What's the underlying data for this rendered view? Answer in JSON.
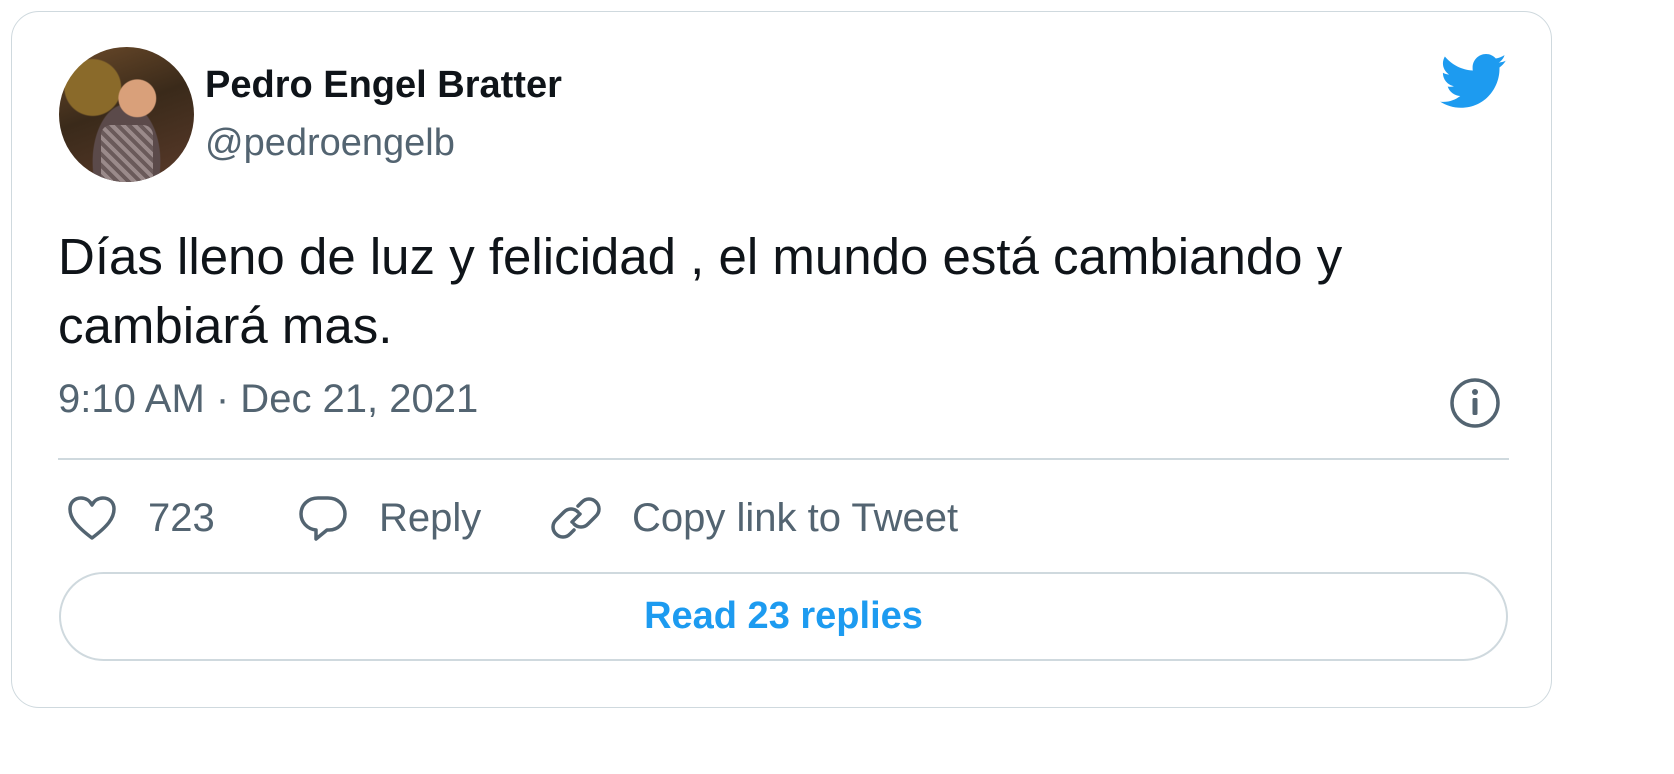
{
  "author": {
    "name": "Pedro Engel Bratter",
    "handle": "@pedroengelb",
    "avatar_icon": "user-photo"
  },
  "tweet": {
    "text": "Días lleno de luz y felicidad , el mundo está cambiando y cambiará mas.",
    "timestamp": "9:10 AM · Dec 21, 2021"
  },
  "actions": {
    "like_count": "723",
    "reply_label": "Reply",
    "copy_label": "Copy link to Tweet"
  },
  "footer": {
    "read_replies_label": "Read 23 replies"
  },
  "icons": {
    "brand": "twitter-bird-icon",
    "info": "info-icon",
    "like": "heart-icon",
    "reply": "speech-bubble-icon",
    "copy": "link-icon"
  },
  "colors": {
    "accent": "#1d9bf0",
    "text_primary": "#0f1419",
    "text_secondary": "#536471",
    "border": "#cfd9de",
    "twitter_blue": "#1d9bf0"
  }
}
